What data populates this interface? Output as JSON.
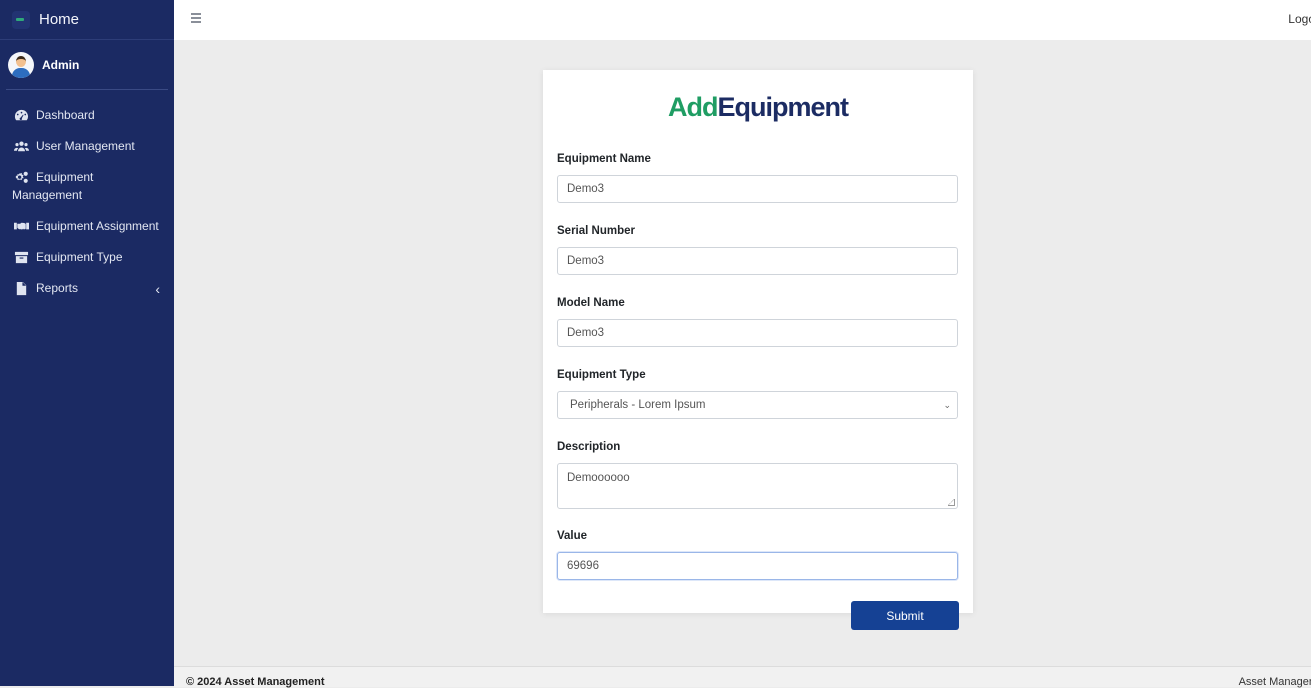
{
  "sidebar": {
    "brand": "Home",
    "user_name": "Admin",
    "items": [
      {
        "label": "Dashboard",
        "icon": "dashboard-icon"
      },
      {
        "label": "User Management",
        "icon": "users-icon"
      },
      {
        "label_line1": "Equipment",
        "label_line2": "Management",
        "icon": "cogs-icon"
      },
      {
        "label": "Equipment Assignment",
        "icon": "handshake-icon"
      },
      {
        "label": "Equipment Type",
        "icon": "archive-icon"
      },
      {
        "label": "Reports",
        "icon": "file-icon",
        "chevron": "‹"
      }
    ]
  },
  "topbar": {
    "logout_label": "Logo"
  },
  "form": {
    "title_part1": "Add",
    "title_part2": "Equipment",
    "fields": [
      {
        "label": "Equipment Name",
        "value": "Demo3"
      },
      {
        "label": "Serial Number",
        "value": "Demo3"
      },
      {
        "label": "Model Name",
        "value": "Demo3"
      },
      {
        "label": "Equipment Type",
        "value": "Peripherals - Lorem Ipsum"
      },
      {
        "label": "Description",
        "value": "Demoooooo"
      },
      {
        "label": "Value",
        "value": "69696"
      }
    ],
    "submit_label": "Submit"
  },
  "footer": {
    "left": "© 2024 Asset Management",
    "right": "Asset Managen"
  },
  "colors": {
    "sidebar_bg": "#1b2a63",
    "title_green": "#1f9d63",
    "title_navy": "#1c2c63",
    "submit_bg": "#154194"
  }
}
